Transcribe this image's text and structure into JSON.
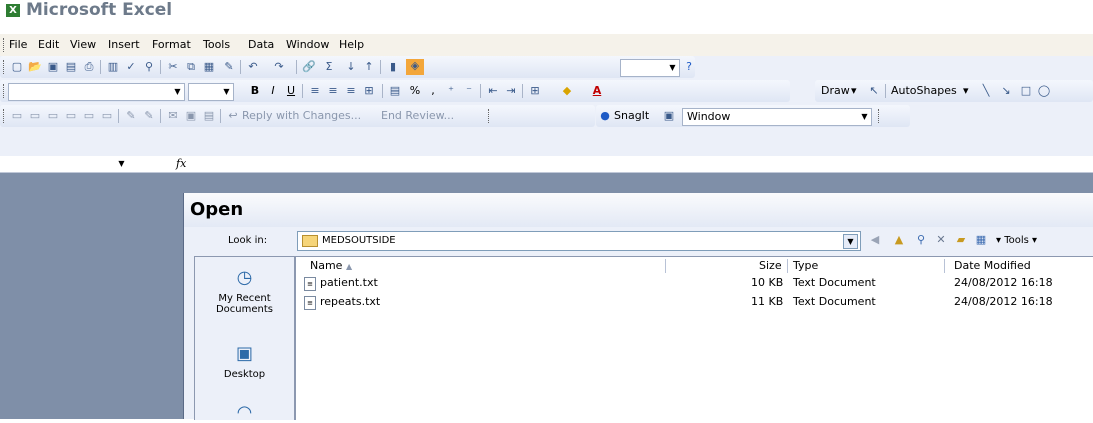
{
  "app": {
    "title": "Microsoft Excel",
    "logo": "X"
  },
  "menu": [
    "File",
    "Edit",
    "View",
    "Insert",
    "Format",
    "Tools",
    "Data",
    "Window",
    "Help"
  ],
  "toolbar_standard": {
    "zoom_value": "",
    "help_icon": "help-icon"
  },
  "toolbar_formatting": {
    "font_name": "",
    "font_size": "",
    "bold": "B",
    "italic": "I",
    "underline": "U",
    "percent": "%",
    "comma": ",",
    "font_color": "A"
  },
  "toolbar_drawing": {
    "draw_label": "Draw",
    "autoshapes_label": "AutoShapes"
  },
  "toolbar_reviewing": {
    "reply_label": "Reply with Changes...",
    "end_review_label": "End Review..."
  },
  "toolbar_snagit": {
    "snagit_label": "SnagIt",
    "capture_mode": "Window"
  },
  "formula_bar": {
    "name_box": "",
    "fx": "fx",
    "content": ""
  },
  "open_dialog": {
    "title": "Open",
    "look_in_label": "Look in:",
    "look_in_value": "MEDSOUTSIDE",
    "tools_label": "Tools",
    "places": [
      {
        "label_line1": "My Recent",
        "label_line2": "Documents",
        "icon": "recent-documents-icon"
      },
      {
        "label_line1": "Desktop",
        "label_line2": "",
        "icon": "desktop-icon"
      }
    ],
    "columns": [
      "Name",
      "Size",
      "Type",
      "Date Modified"
    ],
    "files": [
      {
        "name": "patient.txt",
        "size": "10 KB",
        "type": "Text Document",
        "modified": "24/08/2012 16:18"
      },
      {
        "name": "repeats.txt",
        "size": "11 KB",
        "type": "Text Document",
        "modified": "24/08/2012 16:18"
      }
    ]
  },
  "colors": {
    "workspace": "#7f8fa8",
    "toolbar": "#ecf0f9",
    "title": "#6d7a8a"
  }
}
